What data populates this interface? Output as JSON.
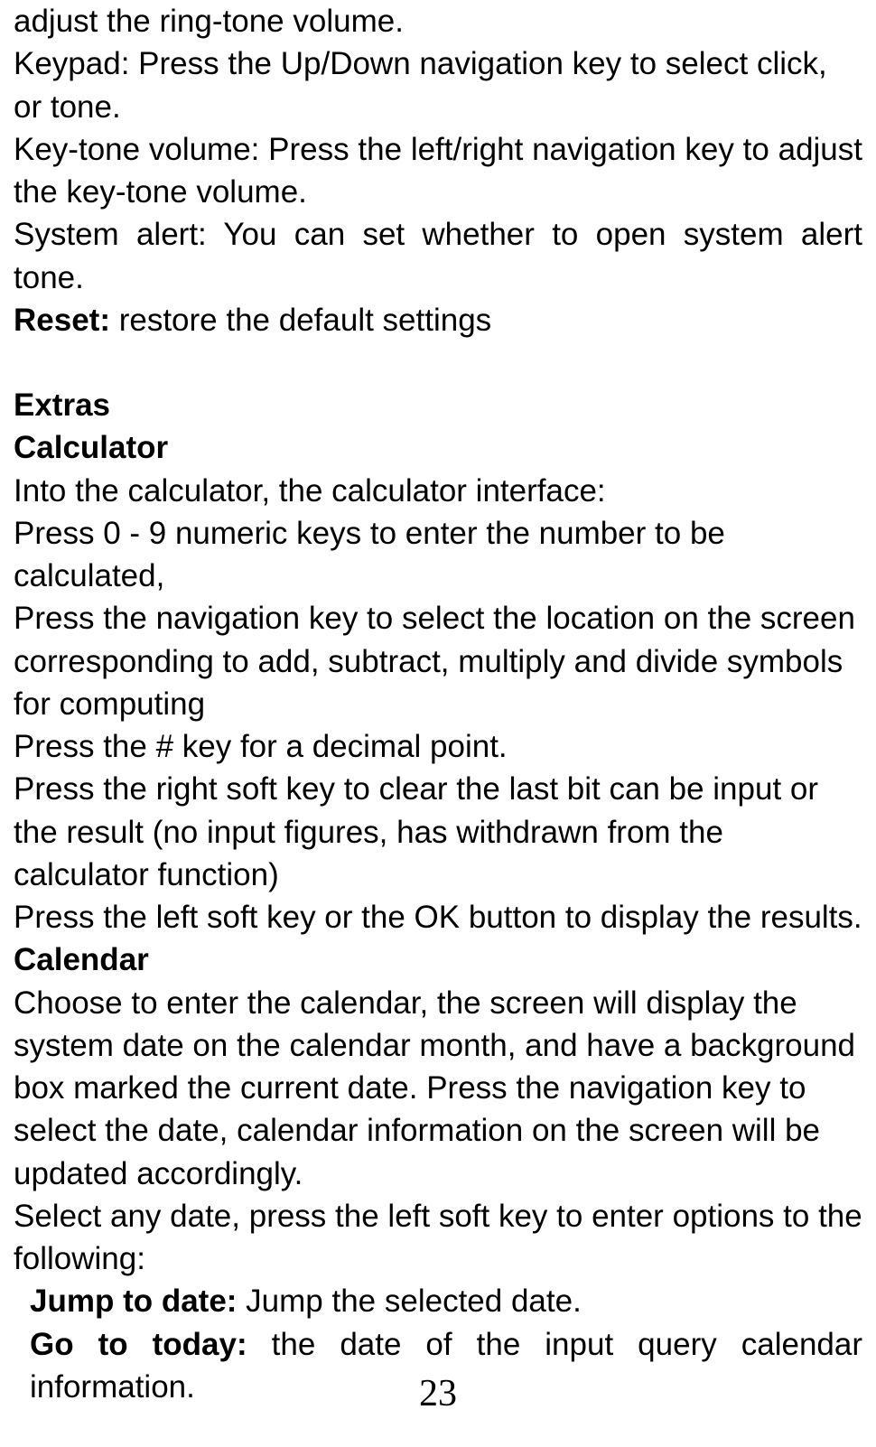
{
  "lines": {
    "l1": "adjust the ring-tone volume.",
    "l2": "Keypad: Press the Up/Down navigation key to select click, or tone.",
    "l3": "Key-tone volume: Press the left/right navigation key to adjust the key-tone volume.",
    "l4": "System alert: You can set whether to open system alert tone.",
    "l5_bold": "Reset:",
    "l5_rest": " restore the default settings",
    "l6": "Extras",
    "l7": "Calculator",
    "l8": "Into the calculator, the calculator interface:",
    "l9": "Press 0 - 9 numeric keys to enter the number to be calculated,",
    "l10": "Press the navigation key to select the location on the screen corresponding to add, subtract, multiply and divide symbols for computing",
    "l11": "Press the # key for a decimal point.",
    "l12": "Press the right soft key to clear the last bit can be input or the result (no input figures, has withdrawn from the calculator function)",
    "l13": "Press the left soft key or the OK button to display the results.",
    "l14": "Calendar",
    "l15": "Choose to enter the calendar, the screen will display the system date on the calendar month, and have a background box marked the current date. Press the navigation key to select the date, calendar information on the screen will be updated accordingly.",
    "l16": "Select any date, press the left soft key to enter options to the following:",
    "l17_bold": "Jump to date:",
    "l17_rest": " Jump the selected date.",
    "l18_bold": "Go to today:",
    "l18_rest": " the date of the input query calendar information."
  },
  "page_number": "23"
}
